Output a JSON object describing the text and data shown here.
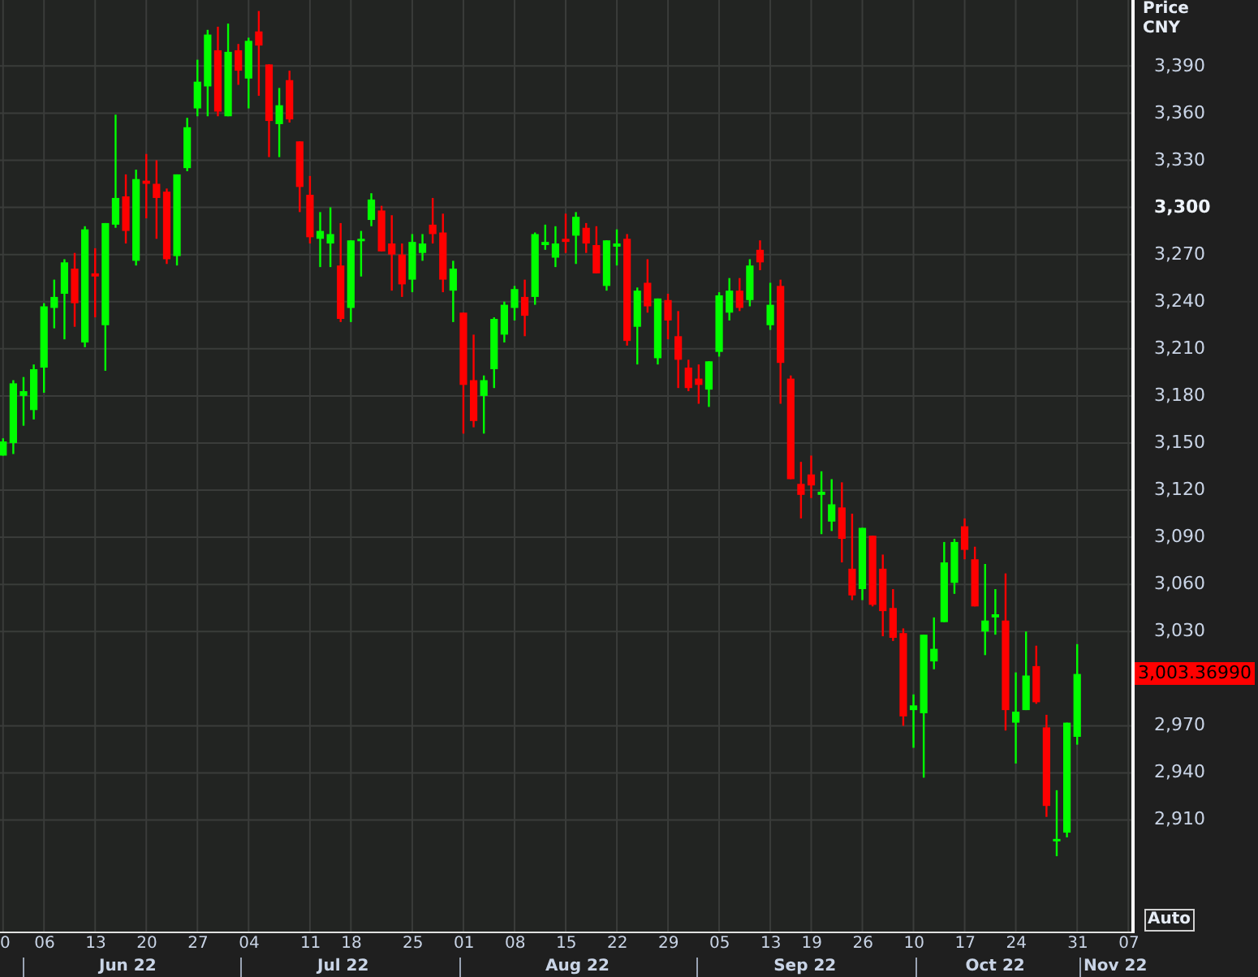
{
  "axis_header": {
    "title": "Price",
    "currency": "CNY"
  },
  "last_price": {
    "label": "3,003.36990"
  },
  "scale_mode": "Auto",
  "months": [
    {
      "label": "Jun 22"
    },
    {
      "label": "Jul 22"
    },
    {
      "label": "Aug 22"
    },
    {
      "label": "Sep 22"
    },
    {
      "label": "Oct 22"
    },
    {
      "label": "Nov 22"
    }
  ],
  "chart_data": {
    "type": "candlestick",
    "ylim": [
      2838,
      3432
    ],
    "yticks": [
      {
        "value": 3390,
        "label": "3,390"
      },
      {
        "value": 3360,
        "label": "3,360"
      },
      {
        "value": 3330,
        "label": "3,330"
      },
      {
        "value": 3300,
        "label": "3,300"
      },
      {
        "value": 3270,
        "label": "3,270"
      },
      {
        "value": 3240,
        "label": "3,240"
      },
      {
        "value": 3210,
        "label": "3,210"
      },
      {
        "value": 3180,
        "label": "3,180"
      },
      {
        "value": 3150,
        "label": "3,150"
      },
      {
        "value": 3120,
        "label": "3,120"
      },
      {
        "value": 3090,
        "label": "3,090"
      },
      {
        "value": 3060,
        "label": "3,060"
      },
      {
        "value": 3030,
        "label": "3,030"
      },
      {
        "value": 2970,
        "label": "2,970"
      },
      {
        "value": 2940,
        "label": "2,940"
      },
      {
        "value": 2910,
        "label": "2,910"
      }
    ],
    "grid": true,
    "categories": [
      "0",
      null,
      null,
      null,
      "06",
      null,
      null,
      null,
      null,
      "13",
      null,
      null,
      null,
      null,
      "20",
      null,
      null,
      null,
      null,
      "27",
      null,
      null,
      null,
      null,
      "04",
      null,
      null,
      null,
      null,
      null,
      "11",
      null,
      null,
      null,
      "18",
      null,
      null,
      null,
      null,
      null,
      "25",
      null,
      null,
      null,
      null,
      "01",
      null,
      null,
      null,
      null,
      "08",
      null,
      null,
      null,
      null,
      "15",
      null,
      null,
      null,
      null,
      "22",
      null,
      null,
      null,
      null,
      "29",
      null,
      null,
      null,
      null,
      "05",
      null,
      null,
      null,
      null,
      "13",
      null,
      null,
      null,
      "19",
      null,
      null,
      null,
      null,
      "26",
      null,
      null,
      null,
      null,
      "10",
      null,
      null,
      null,
      null,
      "17",
      null,
      null,
      null,
      null,
      "24",
      null,
      null,
      null,
      null,
      null,
      "31",
      null,
      null,
      null,
      null,
      "07"
    ],
    "ohlc": [
      [
        3142,
        3153,
        3142,
        3151
      ],
      [
        3150,
        3190,
        3143,
        3188
      ],
      [
        3180,
        3192,
        3161,
        3183
      ],
      [
        3171,
        3200,
        3165,
        3197
      ],
      [
        3198,
        3239,
        3182,
        3237
      ],
      [
        3236,
        3254,
        3223,
        3243
      ],
      [
        3245,
        3267,
        3216,
        3265
      ],
      [
        3261,
        3271,
        3224,
        3239
      ],
      [
        3214,
        3288,
        3211,
        3286
      ],
      [
        3258,
        3274,
        3230,
        3256
      ],
      [
        3225,
        3290,
        3196,
        3290
      ],
      [
        3289,
        3359,
        3287,
        3306
      ],
      [
        3307,
        3321,
        3277,
        3285
      ],
      [
        3266,
        3324,
        3263,
        3318
      ],
      [
        3317,
        3334,
        3293,
        3315
      ],
      [
        3315,
        3330,
        3280,
        3306
      ],
      [
        3310,
        3312,
        3264,
        3267
      ],
      [
        3269,
        3321,
        3263,
        3321
      ],
      [
        3325,
        3357,
        3323,
        3351
      ],
      [
        3363,
        3394,
        3358,
        3380
      ],
      [
        3377,
        3413,
        3358,
        3410
      ],
      [
        3400,
        3415,
        3358,
        3361
      ],
      [
        3358,
        3417,
        3358,
        3399
      ],
      [
        3400,
        3404,
        3378,
        3387
      ],
      [
        3382,
        3408,
        3363,
        3406
      ],
      [
        3412,
        3425,
        3371,
        3403
      ],
      [
        3391,
        3391,
        3332,
        3355
      ],
      [
        3353,
        3376,
        3332,
        3365
      ],
      [
        3381,
        3387,
        3354,
        3356
      ],
      [
        3342,
        3342,
        3297,
        3313
      ],
      [
        3308,
        3320,
        3277,
        3281
      ],
      [
        3280,
        3297,
        3262,
        3285
      ],
      [
        3277,
        3300,
        3262,
        3283
      ],
      [
        3263,
        3290,
        3227,
        3229
      ],
      [
        3236,
        3279,
        3227,
        3279
      ],
      [
        3279,
        3285,
        3256,
        3280
      ],
      [
        3292,
        3309,
        3288,
        3305
      ],
      [
        3298,
        3301,
        3272,
        3272
      ],
      [
        3277,
        3295,
        3247,
        3270
      ],
      [
        3270,
        3277,
        3243,
        3251
      ],
      [
        3254,
        3283,
        3246,
        3278
      ],
      [
        3271,
        3283,
        3266,
        3277
      ],
      [
        3289,
        3306,
        3277,
        3283
      ],
      [
        3284,
        3296,
        3246,
        3254
      ],
      [
        3247,
        3266,
        3227,
        3261
      ],
      [
        3233,
        3233,
        3156,
        3187
      ],
      [
        3190,
        3219,
        3160,
        3164
      ],
      [
        3180,
        3193,
        3156,
        3190
      ],
      [
        3197,
        3230,
        3185,
        3229
      ],
      [
        3219,
        3240,
        3214,
        3238
      ],
      [
        3236,
        3250,
        3228,
        3248
      ],
      [
        3243,
        3254,
        3218,
        3231
      ],
      [
        3243,
        3284,
        3238,
        3283
      ],
      [
        3276,
        3289,
        3273,
        3278
      ],
      [
        3268,
        3288,
        3262,
        3277
      ],
      [
        3280,
        3296,
        3271,
        3278
      ],
      [
        3282,
        3297,
        3264,
        3294
      ],
      [
        3287,
        3290,
        3271,
        3277
      ],
      [
        3276,
        3288,
        3258,
        3258
      ],
      [
        3250,
        3279,
        3247,
        3279
      ],
      [
        3275,
        3286,
        3263,
        3277
      ],
      [
        3280,
        3283,
        3212,
        3215
      ],
      [
        3224,
        3249,
        3200,
        3247
      ],
      [
        3252,
        3267,
        3233,
        3237
      ],
      [
        3204,
        3242,
        3200,
        3242
      ],
      [
        3241,
        3245,
        3216,
        3228
      ],
      [
        3218,
        3234,
        3185,
        3203
      ],
      [
        3198,
        3203,
        3183,
        3185
      ],
      [
        3191,
        3200,
        3175,
        3187
      ],
      [
        3184,
        3202,
        3173,
        3202
      ],
      [
        3208,
        3246,
        3205,
        3244
      ],
      [
        3233,
        3255,
        3228,
        3247
      ],
      [
        3247,
        3255,
        3234,
        3236
      ],
      [
        3241,
        3267,
        3237,
        3263
      ],
      [
        3273,
        3279,
        3260,
        3265
      ],
      [
        3225,
        3252,
        3222,
        3238
      ],
      [
        3250,
        3254,
        3175,
        3201
      ],
      [
        3191,
        3193,
        3127,
        3127
      ],
      [
        3124,
        3138,
        3102,
        3117
      ],
      [
        3130,
        3142,
        3115,
        3123
      ],
      [
        3117,
        3132,
        3092,
        3119
      ],
      [
        3100,
        3127,
        3094,
        3111
      ],
      [
        3109,
        3125,
        3074,
        3089
      ],
      [
        3070,
        3105,
        3050,
        3053
      ],
      [
        3057,
        3096,
        3050,
        3096
      ],
      [
        3091,
        3091,
        3046,
        3047
      ],
      [
        3070,
        3079,
        3027,
        3043
      ],
      [
        3045,
        3057,
        3024,
        3026
      ],
      [
        3029,
        3032,
        2970,
        2976
      ],
      [
        2980,
        2990,
        2956,
        2983
      ],
      [
        2978,
        3028,
        2937,
        3028
      ],
      [
        3011,
        3039,
        3006,
        3019
      ],
      [
        3036,
        3087,
        3036,
        3074
      ],
      [
        3061,
        3089,
        3054,
        3087
      ],
      [
        3097,
        3102,
        3076,
        3082
      ],
      [
        3076,
        3084,
        3046,
        3046
      ],
      [
        3030,
        3073,
        3015,
        3037
      ],
      [
        3039,
        3057,
        3028,
        3041
      ],
      [
        3037,
        3067,
        2967,
        2980
      ],
      [
        2972,
        3004,
        2946,
        2979
      ],
      [
        2980,
        3030,
        2980,
        3002
      ],
      [
        3008,
        3021,
        2984,
        2985
      ],
      [
        2969,
        2977,
        2912,
        2919
      ],
      [
        2897,
        2929,
        2887,
        2898
      ],
      [
        2902,
        2972,
        2899,
        2972
      ],
      [
        2963,
        3022,
        2958,
        3003
      ],
      null,
      null,
      null,
      null,
      null
    ]
  }
}
